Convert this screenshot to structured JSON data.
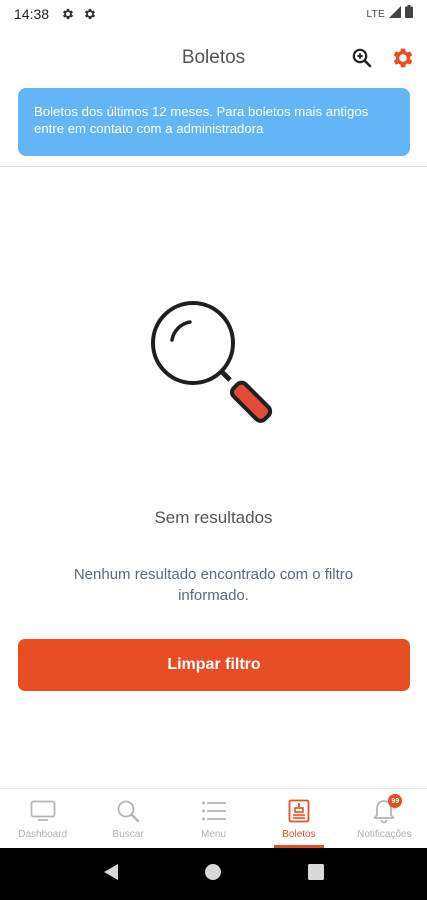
{
  "status_bar": {
    "time": "14:38",
    "network": "LTE"
  },
  "header": {
    "title": "Boletos",
    "accent_color": "#e84e23"
  },
  "banner": {
    "text": "Boletos dos últimos 12 meses. Para boletos mais antigos entre em contato com a administradora",
    "color": "#64b5f6"
  },
  "empty_state": {
    "title": "Sem resultados",
    "description": "Nenhum resultado encontrado com o filtro informado."
  },
  "clear_button": {
    "label": "Limpar filtro"
  },
  "bottom_nav": {
    "items": [
      {
        "label": "Dashboard",
        "icon": "monitor-icon"
      },
      {
        "label": "Buscar",
        "icon": "search-icon"
      },
      {
        "label": "Menu",
        "icon": "menu-icon"
      },
      {
        "label": "Boletos",
        "icon": "invoice-icon",
        "active": true
      },
      {
        "label": "Notificações",
        "icon": "bell-icon",
        "badge": "99"
      }
    ]
  }
}
